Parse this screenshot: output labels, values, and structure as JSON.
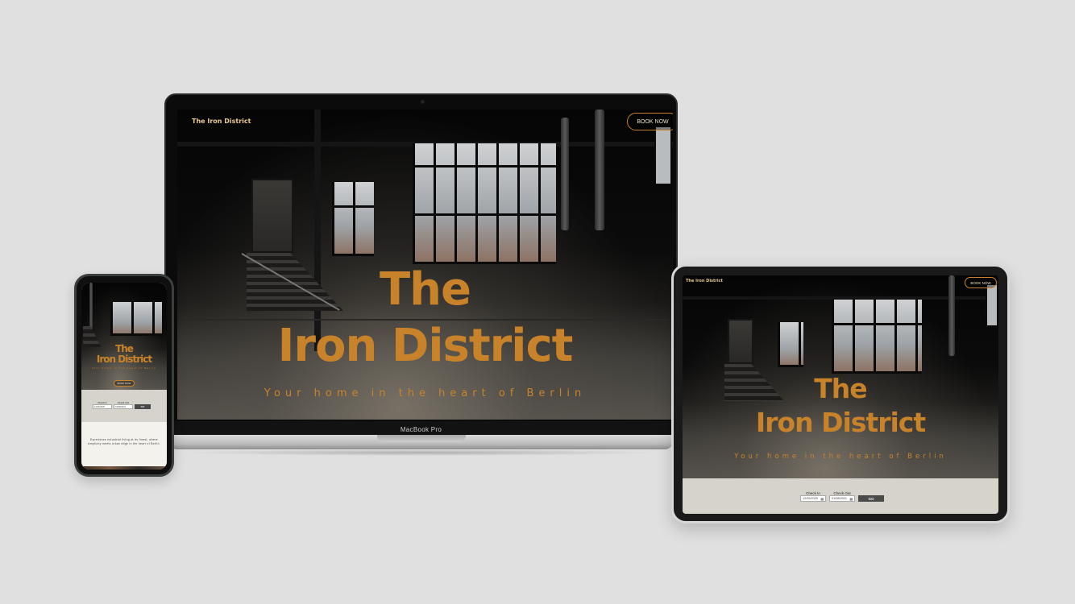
{
  "laptop": {
    "brand": "The Iron District",
    "book_label": "BOOK NOW",
    "title_line1": "The",
    "title_line2": "Iron District",
    "subtitle": "Your home in the heart of Berlin",
    "model_label": "MacBook Pro"
  },
  "tablet": {
    "brand": "The Iron District",
    "book_label": "BOOK NOW",
    "title_line1": "The",
    "title_line2": "Iron District",
    "subtitle": "Your home in the heart of Berlin",
    "checkin_label": "Check In",
    "checkout_label": "Check Out",
    "checkin_value": "12/26/2020",
    "checkout_value": "01/08/2021",
    "go_label": "GO"
  },
  "phone": {
    "title_line1": "The",
    "title_line2": "Iron District",
    "subtitle": "Your home in the heart of Berlin",
    "book_label": "BOOK NOW",
    "checkin_label": "Check In",
    "checkout_label": "Check Out",
    "checkin_value": "12/26/2020",
    "checkout_value": "01/08/2021",
    "go_label": "GO",
    "about_text": "Experience industrial living at its finest, where simplicity meets urban edge in the heart of Berlin."
  },
  "colors": {
    "accent": "#c8832a",
    "background": "#e0e0e0",
    "booking_bar": "#d5d3cc"
  },
  "icons": [
    "calendar-icon"
  ]
}
